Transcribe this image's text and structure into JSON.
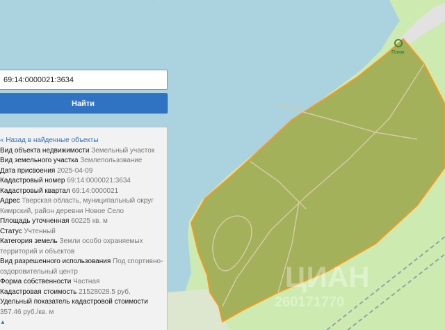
{
  "search": {
    "value": "69:14:0000021:3634",
    "button_label": "Найти"
  },
  "panel": {
    "back_label": "« Назад в найденные объекты",
    "rows": [
      {
        "key": "Вид объекта недвижимости",
        "value": "Земельный участок"
      },
      {
        "key": "Вид земельного участка",
        "value": "Землепользование"
      },
      {
        "key": "Дата присвоения",
        "value": "2025-04-09"
      },
      {
        "key": "Кадастровый номер",
        "value": "69:14:0000021:3634"
      },
      {
        "key": "Кадастровый квартал",
        "value": "69:14:0000021"
      },
      {
        "key": "Адрес",
        "value": "Тверская область, муниципальный округ Кимрский, район деревни Новое Село"
      },
      {
        "key": "Площадь уточненная",
        "value": "60225 кв. м"
      },
      {
        "key": "Статус",
        "value": "Учтенный"
      },
      {
        "key": "Категория земель",
        "value": "Земли особо охраняемых территорий и объектов"
      },
      {
        "key": "Вид разрешенного использования",
        "value": "Под спортивно-оздоровительный центр"
      },
      {
        "key": "Форма собственности",
        "value": "Частная"
      },
      {
        "key": "Кадастровая стоимость",
        "value": "21528028.5 руб."
      },
      {
        "key": "Удельный показатель кадастровой стоимости",
        "value": "357.46 руб./кв. м"
      }
    ],
    "scroll_glyph": "▲"
  },
  "map": {
    "poi_label": "Пляж",
    "watermark_brand": "ЦИАН",
    "watermark_code": "260171770",
    "colors": {
      "water": "#aad3df",
      "grass": "#cdebb0",
      "parcel_fill": "#a2b15a",
      "parcel_stroke": "#f59a23",
      "path": "#d8c9a8",
      "railway": "#9aa0a6"
    }
  }
}
